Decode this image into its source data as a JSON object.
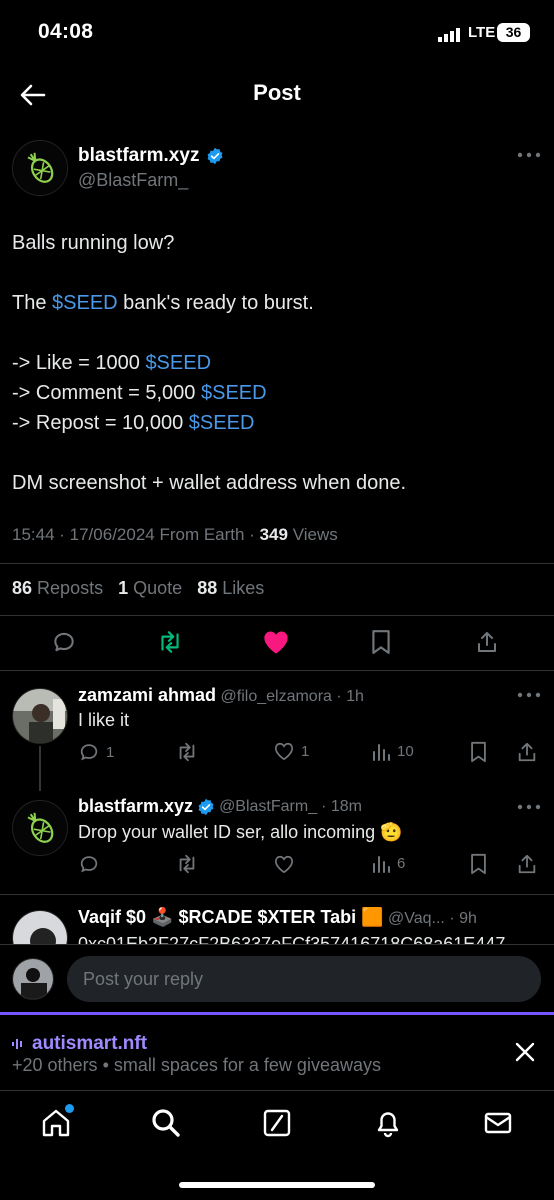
{
  "status_bar": {
    "time": "04:08",
    "network": "LTE",
    "battery": "36"
  },
  "header": {
    "title": "Post"
  },
  "post": {
    "author_name": "blastfarm.xyz",
    "author_handle": "@BlastFarm_",
    "lines": {
      "l1": "Balls running low?",
      "l2_pre": "The ",
      "l2_tag": "$SEED",
      "l2_post": " bank's ready to burst.",
      "l3_pre": "-> Like = 1000 ",
      "l3_tag": "$SEED",
      "l4_pre": "-> Comment = 5,000 ",
      "l4_tag": "$SEED",
      "l5_pre": "-> Repost = 10,000 ",
      "l5_tag": "$SEED",
      "l6": "DM screenshot + wallet address when done."
    },
    "meta_time": "15:44 · 17/06/2024 From Earth · ",
    "views_count": "349",
    "views_label": " Views",
    "reposts_count": "86",
    "reposts_label": "Reposts",
    "quotes_count": "1",
    "quotes_label": "Quote",
    "likes_count": "88",
    "likes_label": "Likes"
  },
  "replies": [
    {
      "name": "zamzami ahmad",
      "handle": "@filo_elzamora",
      "time": "· 1h",
      "text": "I like it",
      "comments": "1",
      "likes": "1",
      "views": "10"
    },
    {
      "name": "blastfarm.xyz",
      "handle": "@BlastFarm_",
      "time": "· 18m",
      "text": "Drop your wallet ID ser, allo incoming 🫡",
      "views": "6"
    },
    {
      "name": "Vaqif $0 🕹️ $RCADE $XTER Tabi 🟧",
      "handle": "@Vaq...",
      "time": "· 9h",
      "text": "0xc01Eb2F27cF2B6337eFCf357416718C68a61E447"
    }
  ],
  "composer": {
    "placeholder": "Post your reply"
  },
  "spaces_banner": {
    "title": "autismart.nft",
    "subtitle": "+20 others • small spaces for a few giveaways"
  },
  "colors": {
    "accent": "#1d9bf0",
    "link": "#4a99e9",
    "like": "#f91880",
    "repost": "#00ba7c",
    "spaces": "#7856ff"
  },
  "icons": [
    "back-arrow-icon",
    "verified-badge-icon",
    "more-icon",
    "reply-icon",
    "repost-icon",
    "heart-icon",
    "bookmark-icon",
    "share-icon",
    "views-icon",
    "home-icon",
    "search-icon",
    "grok-icon",
    "notifications-icon",
    "messages-icon",
    "close-icon"
  ]
}
